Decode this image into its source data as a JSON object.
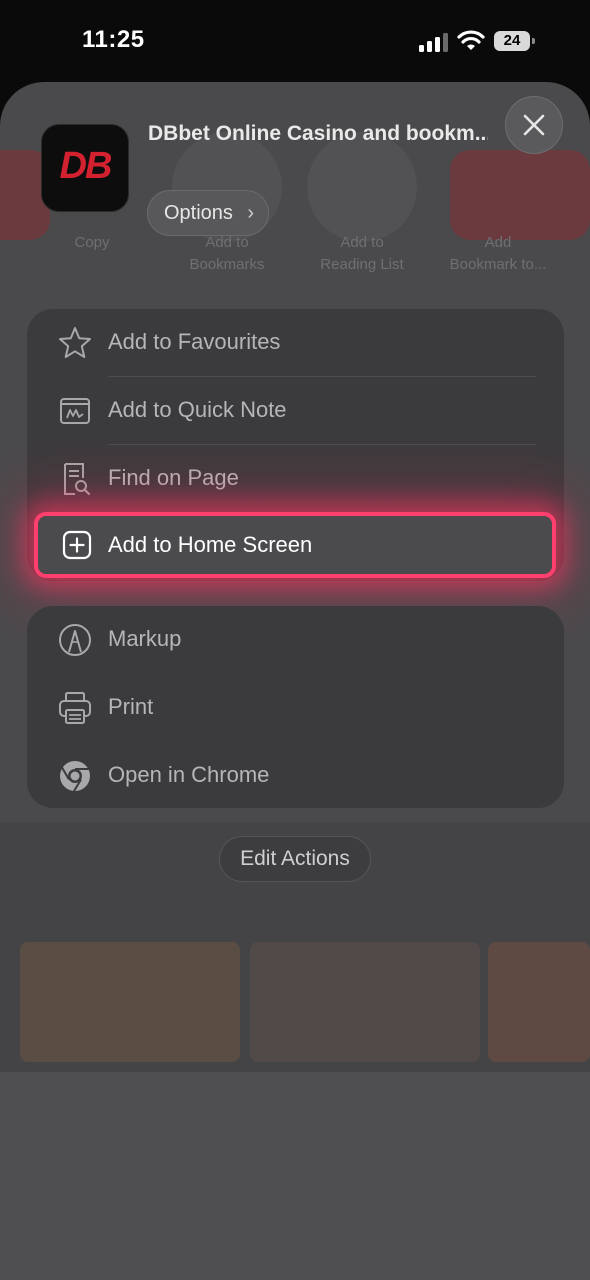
{
  "status_bar": {
    "time": "11:25",
    "battery": "24"
  },
  "header": {
    "app_icon_text": "DB",
    "title": "DBbet Online Casino and bookm...",
    "options_label": "Options",
    "options_chevron": "›"
  },
  "background_actions": [
    {
      "label": "Copy"
    },
    {
      "label": "Add to\nBookmarks"
    },
    {
      "label": "Add to\nReading List"
    },
    {
      "label": "Add\nBookmark to..."
    }
  ],
  "group1": {
    "items": [
      {
        "label": "Add to Favourites",
        "icon": "star-icon"
      },
      {
        "label": "Add to Quick Note",
        "icon": "quick-note-icon"
      },
      {
        "label": "Find on Page",
        "icon": "find-on-page-icon"
      },
      {
        "label": "Add to Home Screen",
        "icon": "plus-square-icon",
        "highlighted": true
      }
    ]
  },
  "group2": {
    "items": [
      {
        "label": "Markup",
        "icon": "markup-pen-icon"
      },
      {
        "label": "Print",
        "icon": "printer-icon"
      },
      {
        "label": "Open in Chrome",
        "icon": "chrome-icon"
      }
    ]
  },
  "edit_actions_label": "Edit Actions",
  "colors": {
    "highlight": "#ff3f6e",
    "brand_red": "#d3212f"
  }
}
